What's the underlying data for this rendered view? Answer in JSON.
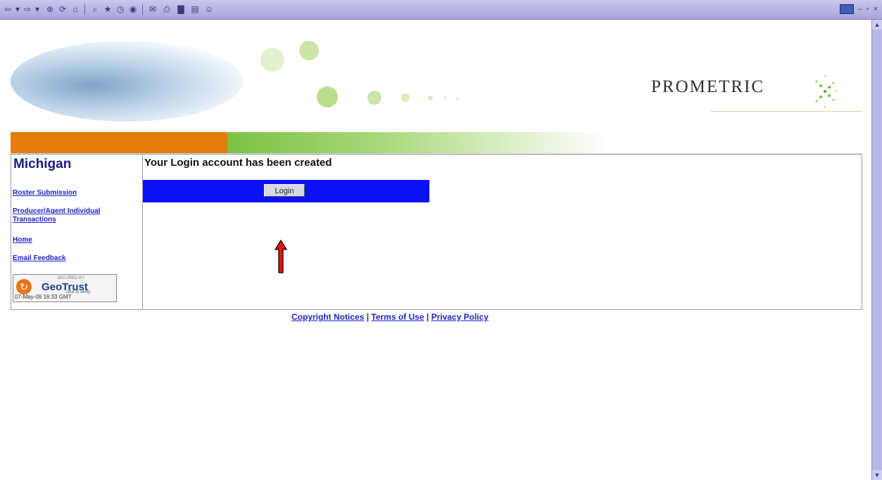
{
  "browser": {
    "toolbar_icons": [
      "back-icon",
      "dropdown-icon",
      "forward-icon",
      "dropdown-icon",
      "stop-icon",
      "refresh-icon",
      "home-icon",
      "search-icon",
      "favorites-icon",
      "history-icon",
      "media-icon",
      "mail-icon",
      "print-icon",
      "edit-icon",
      "discuss-icon",
      "messenger-icon"
    ]
  },
  "header": {
    "logo_text": "PROMETRIC",
    "colors": {
      "orange": "#e57d0e",
      "green": "#7cc243"
    }
  },
  "sidebar": {
    "state": "Michigan",
    "links": [
      {
        "label": "Roster Submission"
      },
      {
        "label": "Producer/Agent Individual Transactions"
      },
      {
        "label": "Home"
      },
      {
        "label": "Email Feedback"
      }
    ],
    "seal": {
      "small_text": "SECURED BY",
      "name": "GeoTrust",
      "click_text": "click to verify",
      "date": "07-May-09 16:33 GMT"
    }
  },
  "main": {
    "message": "Your Login account has been created",
    "login_button": "Login",
    "accent_color": "#0a12f5"
  },
  "footer": {
    "links": [
      "Copyright Notices",
      "Terms of Use",
      "Privacy Policy"
    ],
    "separator": "|"
  }
}
